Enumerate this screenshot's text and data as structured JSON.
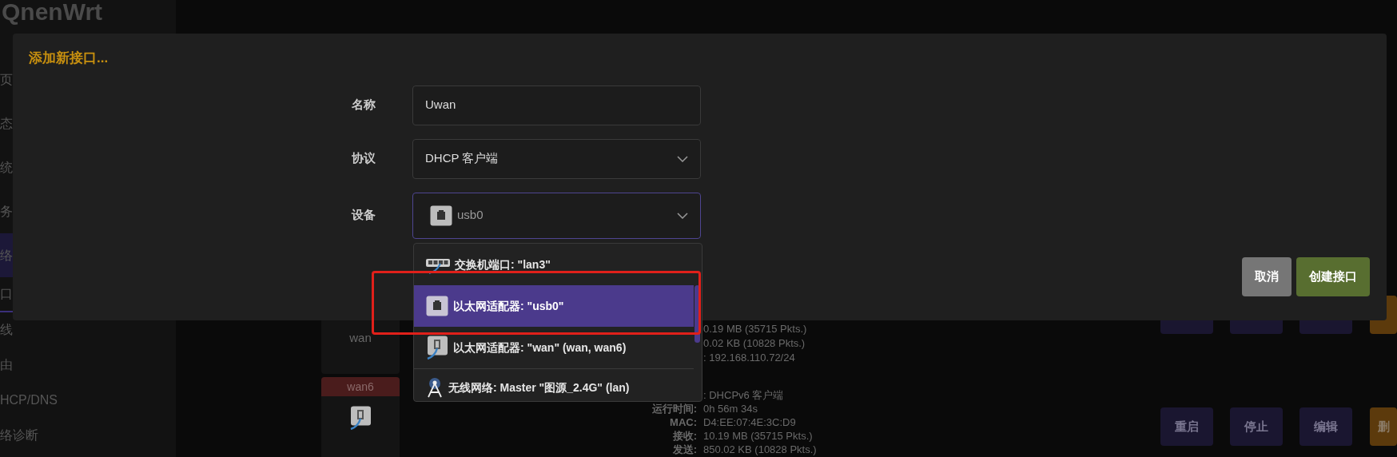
{
  "brand": "QnenWrt",
  "sidebar": {
    "items": [
      {
        "label": "页",
        "kind": "section",
        "selected": false
      },
      {
        "label": "态",
        "kind": "section",
        "selected": false
      },
      {
        "label": "统",
        "kind": "section",
        "selected": false
      },
      {
        "label": "务",
        "kind": "section",
        "selected": false
      },
      {
        "label": "络",
        "kind": "section",
        "selected": true
      },
      {
        "label": "口",
        "kind": "page",
        "selected": true
      },
      {
        "label": "线",
        "kind": "page",
        "selected": false
      },
      {
        "label": "由",
        "kind": "page",
        "selected": false
      },
      {
        "label": "HCP/DNS",
        "kind": "page",
        "selected": false
      },
      {
        "label": "络诊断",
        "kind": "page",
        "selected": false
      }
    ]
  },
  "interfaces": [
    {
      "name": "wan",
      "info": [
        {
          "value": "0.19 MB (35715 Pkts.)"
        },
        {
          "value": "0.02 KB (10828 Pkts.)"
        },
        {
          "value": ": 192.168.110.72/24"
        }
      ],
      "actions": [
        {
          "kind": "neutral"
        },
        {
          "kind": "neutral"
        },
        {
          "kind": "neutral"
        },
        {
          "kind": "danger"
        }
      ]
    },
    {
      "badge": "wan6",
      "info": [
        {
          "value": ": DHCPv6 客户端"
        },
        {
          "label": "运行时间:",
          "value": "0h 56m 34s"
        },
        {
          "label": "MAC:",
          "value": "D4:EE:07:4E:3C:D9"
        },
        {
          "label": "接收:",
          "value": "10.19 MB (35715 Pkts.)"
        },
        {
          "label": "发送:",
          "value": "850.02 KB (10828 Pkts.)"
        }
      ],
      "actions": [
        {
          "label": "重启",
          "kind": "neutral"
        },
        {
          "label": "停止",
          "kind": "neutral"
        },
        {
          "label": "编辑",
          "kind": "neutral"
        },
        {
          "label": "删",
          "kind": "danger"
        }
      ]
    }
  ],
  "dialog": {
    "title": "添加新接口...",
    "fields": [
      {
        "label": "名称",
        "kind": "text",
        "value": "Uwan"
      },
      {
        "label": "协议",
        "kind": "select",
        "value": "DHCP 客户端"
      },
      {
        "label": "设备",
        "kind": "device",
        "value": "usb0",
        "focused": true
      }
    ],
    "dropdown": [
      {
        "label": "交换机端口: \"lan3\"",
        "kind": "switch",
        "selected": false
      },
      {
        "label": "以太网适配器: \"usb0\"",
        "kind": "ethernet",
        "selected": true
      },
      {
        "label": "以太网适配器: \"wan\" (wan, wan6)",
        "kind": "cable",
        "selected": false
      },
      {
        "label": "无线网络: Master \"图源_2.4G\" (lan)",
        "kind": "wireless",
        "selected": false
      }
    ],
    "buttons": [
      {
        "label": "取消",
        "kind": "secondary"
      },
      {
        "label": "创建接口",
        "kind": "primary"
      }
    ]
  }
}
